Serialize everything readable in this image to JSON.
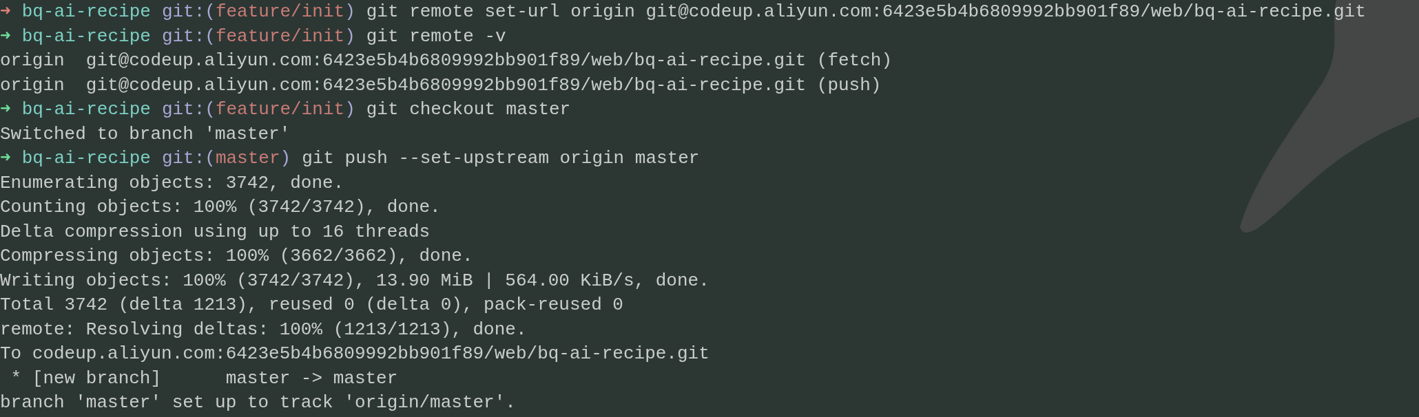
{
  "terminal": {
    "lines": [
      {
        "kind": "prompt",
        "success": false,
        "arrow": "➜",
        "directory": "bq-ai-recipe",
        "git_open": "git:(",
        "branch": "feature/init",
        "git_close": ")",
        "command": "git remote set-url origin git@codeup.aliyun.com:6423e5b4b6809992bb901f89/web/bq-ai-recipe.git"
      },
      {
        "kind": "prompt",
        "success": true,
        "arrow": "➜",
        "directory": "bq-ai-recipe",
        "git_open": "git:(",
        "branch": "feature/init",
        "git_close": ")",
        "command": "git remote -v"
      },
      {
        "kind": "output",
        "text": "origin  git@codeup.aliyun.com:6423e5b4b6809992bb901f89/web/bq-ai-recipe.git (fetch)"
      },
      {
        "kind": "output",
        "text": "origin  git@codeup.aliyun.com:6423e5b4b6809992bb901f89/web/bq-ai-recipe.git (push)"
      },
      {
        "kind": "prompt",
        "success": true,
        "arrow": "➜",
        "directory": "bq-ai-recipe",
        "git_open": "git:(",
        "branch": "feature/init",
        "git_close": ")",
        "command": "git checkout master"
      },
      {
        "kind": "output",
        "text": "Switched to branch 'master'"
      },
      {
        "kind": "prompt",
        "success": true,
        "arrow": "➜",
        "directory": "bq-ai-recipe",
        "git_open": "git:(",
        "branch": "master",
        "git_close": ")",
        "command": "git push --set-upstream origin master"
      },
      {
        "kind": "output",
        "text": "Enumerating objects: 3742, done."
      },
      {
        "kind": "output",
        "text": "Counting objects: 100% (3742/3742), done."
      },
      {
        "kind": "output",
        "text": "Delta compression using up to 16 threads"
      },
      {
        "kind": "output",
        "text": "Compressing objects: 100% (3662/3662), done."
      },
      {
        "kind": "output",
        "text": "Writing objects: 100% (3742/3742), 13.90 MiB | 564.00 KiB/s, done."
      },
      {
        "kind": "output",
        "text": "Total 3742 (delta 1213), reused 0 (delta 0), pack-reused 0"
      },
      {
        "kind": "output",
        "text": "remote: Resolving deltas: 100% (1213/1213), done."
      },
      {
        "kind": "output",
        "text": "To codeup.aliyun.com:6423e5b4b6809992bb901f89/web/bq-ai-recipe.git"
      },
      {
        "kind": "output",
        "text": " * [new branch]      master -> master"
      },
      {
        "kind": "output",
        "text": "branch 'master' set up to track 'origin/master'."
      }
    ]
  }
}
